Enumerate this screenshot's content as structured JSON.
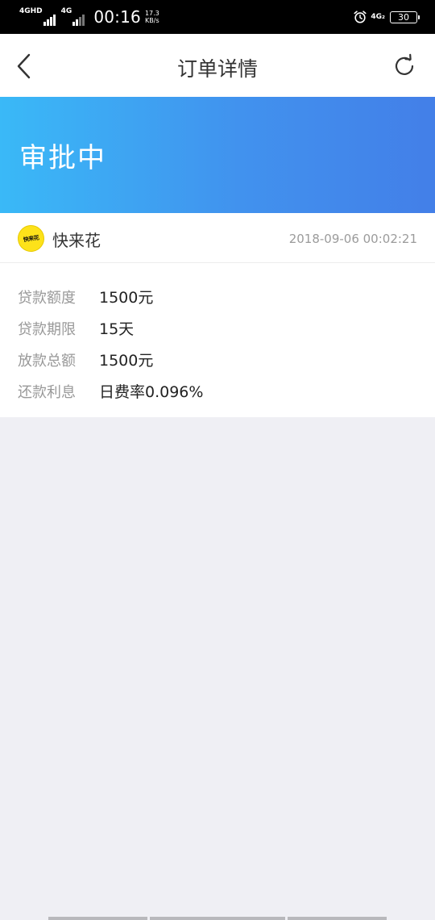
{
  "status_bar": {
    "sim1_label": "4GHD",
    "sim2_label": "4G",
    "time": "00:16",
    "speed_value": "17.3",
    "speed_unit": "KB/s",
    "net_right": "4G₂",
    "battery": "30"
  },
  "nav": {
    "title": "订单详情",
    "back_icon": "chevron-left-icon",
    "refresh_icon": "refresh-icon"
  },
  "banner": {
    "status_text": "审批中",
    "gradient_start": "#3ab9f7",
    "gradient_end": "#437fe8"
  },
  "order": {
    "lender_logo_text": "快来花",
    "lender_name": "快来花",
    "created_at": "2018-09-06 00:02:21",
    "details": [
      {
        "label": "贷款额度",
        "value": "1500元"
      },
      {
        "label": "贷款期限",
        "value": "15天"
      },
      {
        "label": "放款总额",
        "value": "1500元"
      },
      {
        "label": "还款利息",
        "value": "日费率0.096%"
      }
    ]
  },
  "colors": {
    "page_background": "#efeff4",
    "status_bar_background": "#000000",
    "logo_yellow": "#fde21a"
  }
}
